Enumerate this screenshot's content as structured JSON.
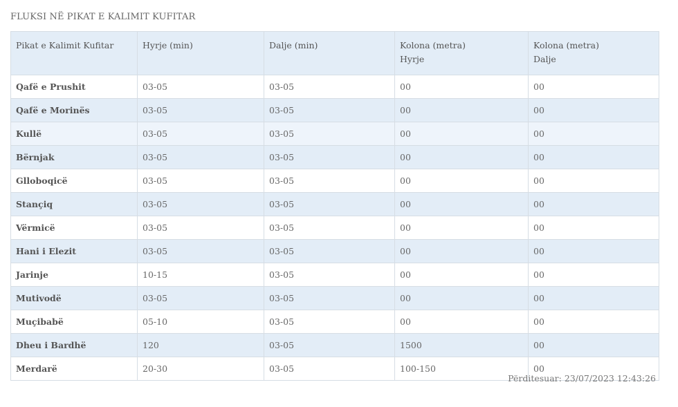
{
  "title": "FLUKSI NË PIKAT E KALIMIT KUFITAR",
  "table": {
    "headers": [
      "Pikat e Kalimit Kufitar",
      "Hyrje (min)",
      "Dalje (min)",
      [
        "Kolona (metra)",
        "Hyrje"
      ],
      [
        "Kolona (metra)",
        "Dalje"
      ]
    ],
    "header_lines": {
      "h1": "Pikat e Kalimit Kufitar",
      "h2": "Hyrje (min)",
      "h3": "Dalje (min)",
      "h4a": "Kolona (metra)",
      "h4b": "Hyrje",
      "h5a": "Kolona (metra)",
      "h5b": "Dalje"
    },
    "rows": [
      [
        "Qafë e Prushit",
        "03-05",
        "03-05",
        "00",
        "00"
      ],
      [
        "Qafë e Morinës",
        "03-05",
        "03-05",
        "00",
        "00"
      ],
      [
        "Kullë",
        "03-05",
        "03-05",
        "00",
        "00"
      ],
      [
        "Bërnjak",
        "03-05",
        "03-05",
        "00",
        "00"
      ],
      [
        "Glloboqicë",
        "03-05",
        "03-05",
        "00",
        "00"
      ],
      [
        "Stançiq",
        "03-05",
        "03-05",
        "00",
        "00"
      ],
      [
        "Vërmicë",
        "03-05",
        "03-05",
        "00",
        "00"
      ],
      [
        "Hani i Elezit",
        "03-05",
        "03-05",
        "00",
        "00"
      ],
      [
        "Jarinje",
        "10-15",
        "03-05",
        "00",
        "00"
      ],
      [
        "Mutivodë",
        "03-05",
        "03-05",
        "00",
        "00"
      ],
      [
        "Muçibabë",
        "05-10",
        "03-05",
        "00",
        "00"
      ],
      [
        "Dheu i Bardhë",
        "120",
        "03-05",
        "1500",
        "00"
      ],
      [
        "Merdarë",
        "20-30",
        "03-05",
        "100-150",
        "00"
      ]
    ],
    "row_shading": [
      "white",
      "blue",
      "light",
      "blue",
      "white",
      "blue",
      "white",
      "blue",
      "white",
      "blue",
      "white",
      "blue",
      "white"
    ]
  },
  "updated": "Përditesuar: 23/07/2023 12:43:26",
  "colors": {
    "header_bg": "#e3edf7",
    "stripe_bg": "#e3edf7",
    "light_bg": "#eef4fb",
    "border": "#d6dde4"
  }
}
